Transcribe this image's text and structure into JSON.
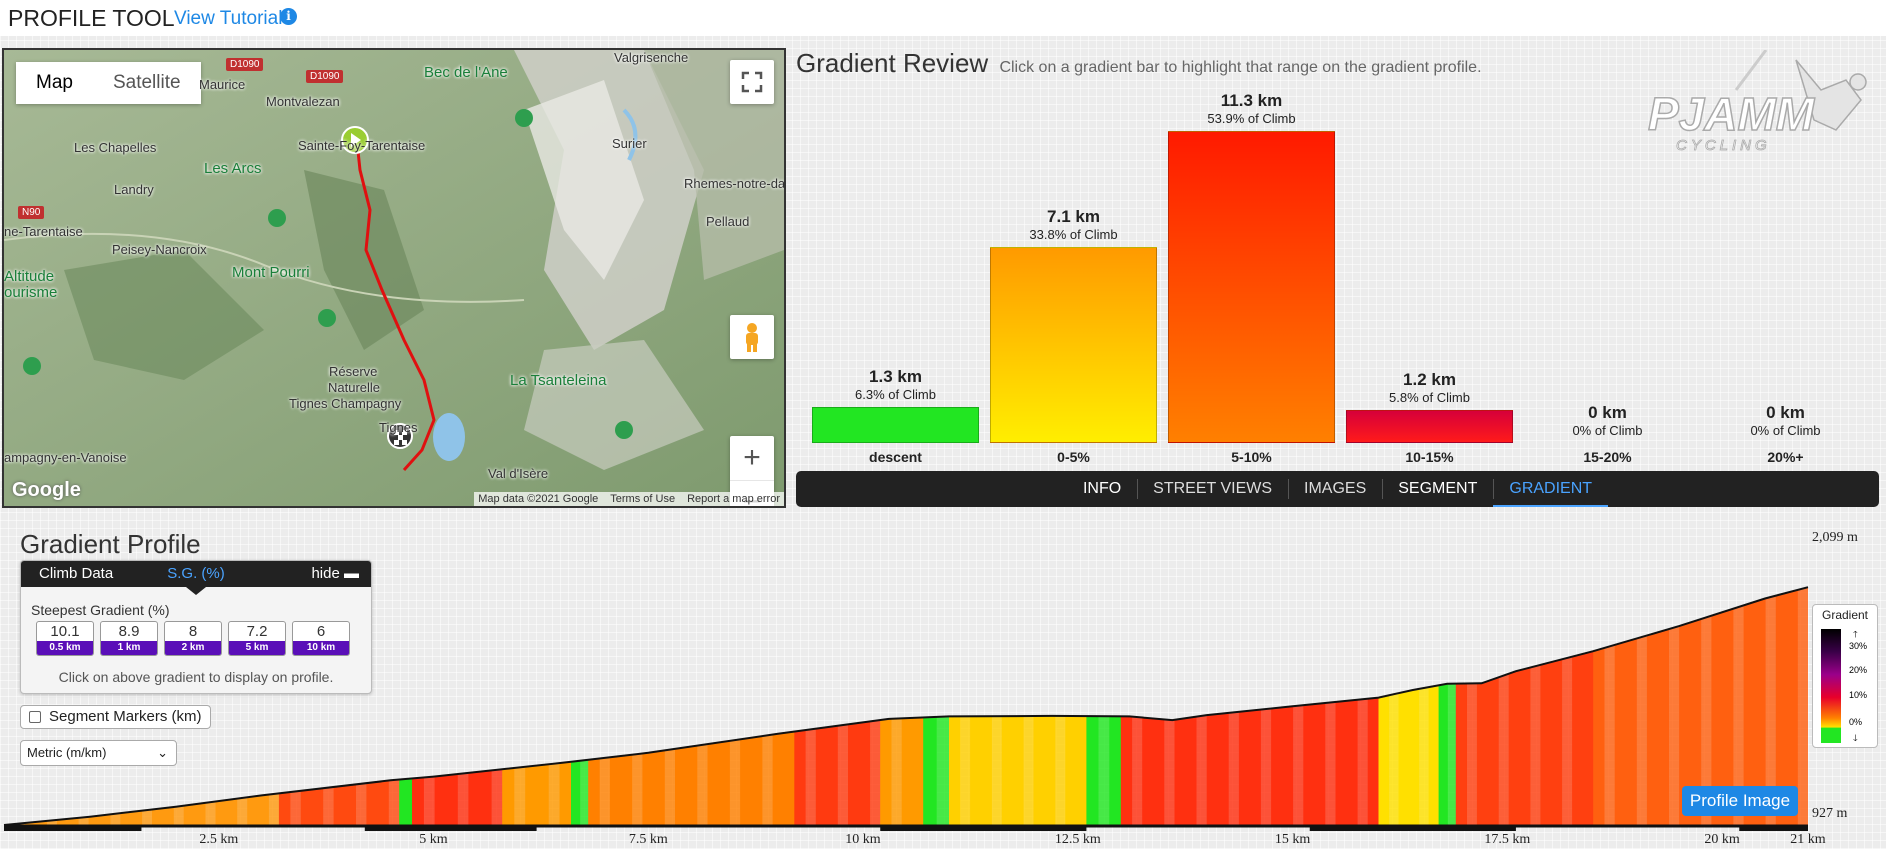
{
  "header": {
    "title": "PROFILE TOOL",
    "tutorial_link": "View Tutorial"
  },
  "map": {
    "type_buttons": [
      "Map",
      "Satellite"
    ],
    "labels": {
      "d1090a": "D1090",
      "d1090b": "D1090",
      "n90": "N90",
      "maurice": "Maurice",
      "montvalezan": "Montvalezan",
      "valgrisenche": "Valgrisenche",
      "bec": "Bec de l'Ane",
      "chapelles": "Les Chapelles",
      "lesarcs": "Les Arcs",
      "saintefoy": "Sainte-Foy-Tarentaise",
      "surier": "Surier",
      "landry": "Landry",
      "rhemes": "Rhemes-notre-dar",
      "netarentaise": "ne-Tarentaise",
      "pellaud": "Pellaud",
      "peisey": "Peisey-Nancroix",
      "montpourri": "Mont Pourri",
      "altitude1": "Altitude",
      "altitude2": "ourisme",
      "reserve1": "Réserve",
      "reserve2": "Naturelle",
      "reserve3": "Tignes Champagny",
      "tsanteleina": "La Tsanteleina",
      "tignes": "Tignes",
      "champagny": "ampagny-en-Vanoise",
      "valdisere": "Val d'Isère"
    },
    "attribution": [
      "Map data ©2021 Google",
      "Terms of Use",
      "Report a map error"
    ],
    "logo_text": "Google",
    "route_color": "#e01010"
  },
  "gradient_review": {
    "title": "Gradient Review",
    "hint": "Click on a gradient bar to highlight that range on the gradient profile.",
    "bars": [
      {
        "category": "descent",
        "distance": "1.3 km",
        "percent": "6.3% of Climb",
        "km": 1.3,
        "color_top": "#22e622",
        "color_bottom": "#22e622"
      },
      {
        "category": "0-5%",
        "distance": "7.1 km",
        "percent": "33.8% of Climb",
        "km": 7.1,
        "color_top": "#ff9a00",
        "color_bottom": "#ffee00"
      },
      {
        "category": "5-10%",
        "distance": "11.3 km",
        "percent": "53.9% of Climb",
        "km": 11.3,
        "color_top": "#ff1a00",
        "color_bottom": "#ff8000"
      },
      {
        "category": "10-15%",
        "distance": "1.2 km",
        "percent": "5.8% of Climb",
        "km": 1.2,
        "color_top": "#d6003a",
        "color_bottom": "#ff1a1a"
      },
      {
        "category": "15-20%",
        "distance": "0 km",
        "percent": "0% of Climb",
        "km": 0,
        "color_top": "#8b0060",
        "color_bottom": "#8b0060"
      },
      {
        "category": "20%+",
        "distance": "0 km",
        "percent": "0% of Climb",
        "km": 0,
        "color_top": "#400040",
        "color_bottom": "#400040"
      }
    ]
  },
  "logo": {
    "brand": "PJAMM",
    "sub": "CYCLING"
  },
  "tabs": [
    {
      "label": "INFO",
      "state": "normal"
    },
    {
      "label": "STREET VIEWS",
      "state": "muted"
    },
    {
      "label": "IMAGES",
      "state": "muted"
    },
    {
      "label": "SEGMENT",
      "state": "normal"
    },
    {
      "label": "GRADIENT",
      "state": "active"
    }
  ],
  "profile": {
    "title": "Gradient Profile",
    "climb_tabs": {
      "climb_data": "Climb Data",
      "sg": "S.G. (%)",
      "hide": "hide"
    },
    "steepest_label": "Steepest Gradient (%)",
    "steepest": [
      {
        "value": "10.1",
        "length": "0.5 km"
      },
      {
        "value": "8.9",
        "length": "1 km"
      },
      {
        "value": "8",
        "length": "2 km"
      },
      {
        "value": "7.2",
        "length": "5 km"
      },
      {
        "value": "6",
        "length": "10 km"
      }
    ],
    "hint": "Click on above gradient to display on profile.",
    "segment_markers": "Segment Markers (km)",
    "units_select": "Metric (m/km)",
    "elevation_max": "2,099 m",
    "elevation_min": "927 m",
    "distance_ticks": [
      {
        "km": 2.5,
        "label": "2.5 km"
      },
      {
        "km": 5,
        "label": "5 km"
      },
      {
        "km": 7.5,
        "label": "7.5 km"
      },
      {
        "km": 10,
        "label": "10 km"
      },
      {
        "km": 12.5,
        "label": "12.5 km"
      },
      {
        "km": 15,
        "label": "15 km"
      },
      {
        "km": 17.5,
        "label": "17.5 km"
      },
      {
        "km": 20,
        "label": "20 km"
      },
      {
        "km": 21,
        "label": "21 km"
      }
    ],
    "total_km": 21,
    "elev_min_m": 927,
    "elev_max_m": 2099,
    "elevation_points": [
      [
        0,
        927
      ],
      [
        1,
        960
      ],
      [
        2,
        1000
      ],
      [
        3,
        1045
      ],
      [
        4.5,
        1105
      ],
      [
        5,
        1120
      ],
      [
        6.5,
        1175
      ],
      [
        7.5,
        1215
      ],
      [
        9,
        1290
      ],
      [
        10.3,
        1350
      ],
      [
        11,
        1360
      ],
      [
        12.2,
        1362
      ],
      [
        13.1,
        1360
      ],
      [
        13.6,
        1345
      ],
      [
        14,
        1365
      ],
      [
        15,
        1400
      ],
      [
        16,
        1435
      ],
      [
        16.4,
        1465
      ],
      [
        16.8,
        1490
      ],
      [
        17.2,
        1492
      ],
      [
        17.6,
        1540
      ],
      [
        18.5,
        1620
      ],
      [
        19.5,
        1720
      ],
      [
        20.5,
        1830
      ],
      [
        21,
        1875
      ]
    ],
    "gradient_segments": [
      {
        "from": 0,
        "to": 3.2,
        "color": "#ff9a10"
      },
      {
        "from": 3.2,
        "to": 4.6,
        "color": "#ff4a10"
      },
      {
        "from": 4.6,
        "to": 4.75,
        "color": "#22e622"
      },
      {
        "from": 4.75,
        "to": 5.8,
        "color": "#ff3010"
      },
      {
        "from": 5.8,
        "to": 6.6,
        "color": "#ff9a00"
      },
      {
        "from": 6.6,
        "to": 6.8,
        "color": "#22e622"
      },
      {
        "from": 6.8,
        "to": 9.2,
        "color": "#ff8000"
      },
      {
        "from": 9.2,
        "to": 10.2,
        "color": "#ff3a10"
      },
      {
        "from": 10.2,
        "to": 10.7,
        "color": "#ff9a00"
      },
      {
        "from": 10.7,
        "to": 11.0,
        "color": "#22e622"
      },
      {
        "from": 11.0,
        "to": 12.6,
        "color": "#ffd000"
      },
      {
        "from": 12.6,
        "to": 13.0,
        "color": "#22e622"
      },
      {
        "from": 13.0,
        "to": 16.0,
        "color": "#ff3010"
      },
      {
        "from": 16.0,
        "to": 16.7,
        "color": "#ffe000"
      },
      {
        "from": 16.7,
        "to": 16.9,
        "color": "#22e622"
      },
      {
        "from": 16.9,
        "to": 18.5,
        "color": "#ff4010"
      },
      {
        "from": 18.5,
        "to": 21,
        "color": "#ff6010"
      }
    ],
    "legend": {
      "title": "Gradient",
      "ticks": [
        "30%",
        "20%",
        "10%",
        "0%"
      ]
    },
    "profile_image_button": "Profile Image"
  }
}
